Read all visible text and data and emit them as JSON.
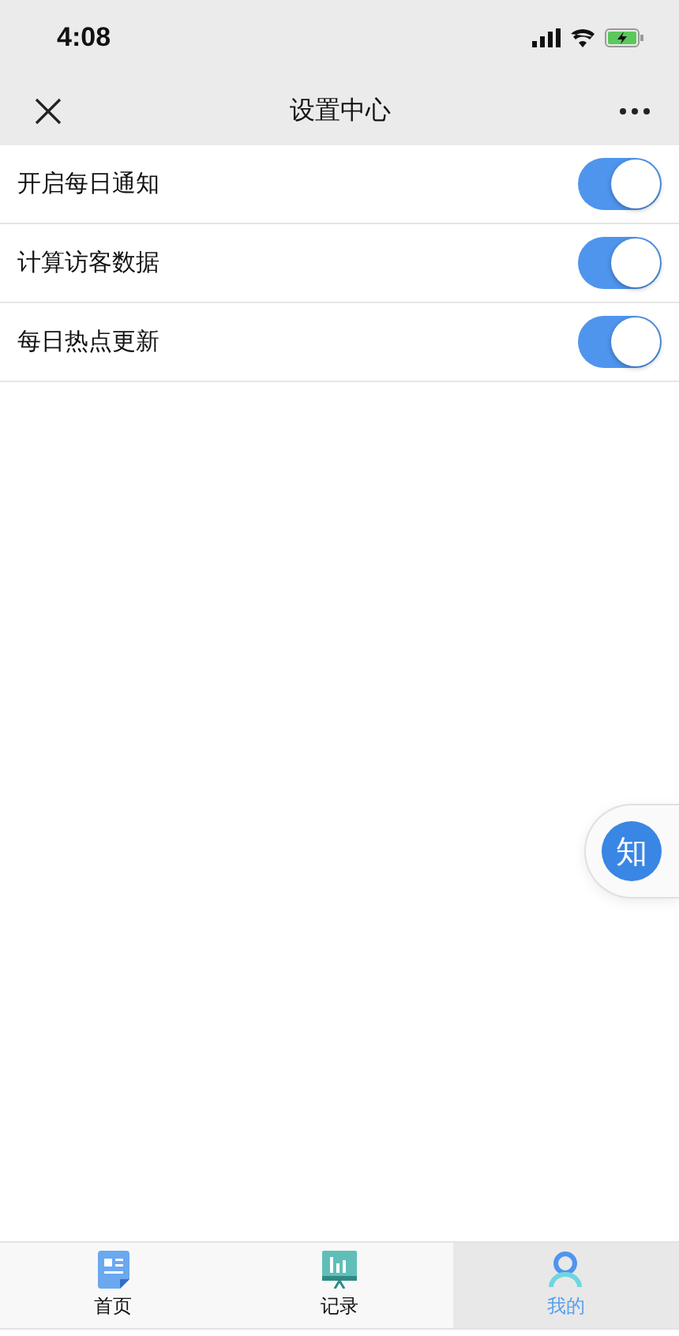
{
  "status_bar": {
    "time": "4:08"
  },
  "nav": {
    "title": "设置中心"
  },
  "settings": [
    {
      "label": "开启每日通知",
      "on": true
    },
    {
      "label": "计算访客数据",
      "on": true
    },
    {
      "label": "每日热点更新",
      "on": true
    }
  ],
  "floating_button": {
    "label": "知"
  },
  "tab_bar": [
    {
      "label": "首页",
      "kind": "document",
      "selected": false
    },
    {
      "label": "记录",
      "kind": "board",
      "selected": false
    },
    {
      "label": "我的",
      "kind": "person",
      "selected": true
    }
  ]
}
